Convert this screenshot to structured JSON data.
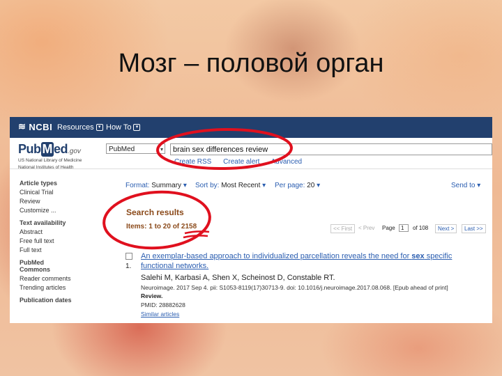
{
  "slide": {
    "title": "Мозг – половой орган"
  },
  "ncbi": {
    "logo": "NCBI",
    "resources": "Resources",
    "howto": "How To"
  },
  "pubmed": {
    "logo_pub": "Pub",
    "logo_m": "M",
    "logo_ed": "ed",
    "logo_gov": ".gov",
    "sub1": "US National Library of Medicine",
    "sub2": "National Institutes of Health"
  },
  "search": {
    "database": "PubMed",
    "query": "brain sex differences review",
    "links": [
      "Create RSS",
      "Create alert",
      "Advanced"
    ]
  },
  "sidebar": {
    "article_types": "Article types",
    "article_items": [
      "Clinical Trial",
      "Review",
      "Customize ..."
    ],
    "text_availability": "Text availability",
    "text_items": [
      "Abstract",
      "Free full text",
      "Full text"
    ],
    "pubmed_commons": "PubMed Commons",
    "commons_items": [
      "Reader comments",
      "Trending articles"
    ],
    "publication_dates": "Publication dates"
  },
  "toolbar": {
    "format_label": "Format:",
    "format_value": "Summary",
    "sort_label": "Sort by:",
    "sort_value": "Most Recent",
    "perpage_label": "Per page:",
    "perpage_value": "20",
    "sendto": "Send to"
  },
  "results": {
    "heading": "Search results",
    "count": "Items: 1 to 20 of 2158"
  },
  "pager": {
    "first": "<< First",
    "prev": "< Prev",
    "page_label": "Page",
    "page_value": "1",
    "of": "of 108",
    "next": "Next >",
    "last": "Last >>"
  },
  "result1": {
    "number": "1.",
    "title_a": "An exemplar-based approach to individualized parcellation reveals the need for ",
    "title_b": "sex",
    "title_c": " specific functional networks.",
    "authors": "Salehi M, Karbasi A, Shen X, Scheinost D, Constable RT.",
    "journal": "Neuroimage. 2017 Sep 4. pii: S1053-8119(17)30713-9. doi: 10.1016/j.neuroimage.2017.08.068. [Epub ahead of print]",
    "type": "Review.",
    "pmid": "PMID: 28882628",
    "similar": "Similar articles"
  },
  "colors": {
    "ncbi_bar": "#22406e",
    "link": "#2a5db0",
    "results_brown": "#8b4a1a",
    "annotation_red": "#e0101e"
  }
}
